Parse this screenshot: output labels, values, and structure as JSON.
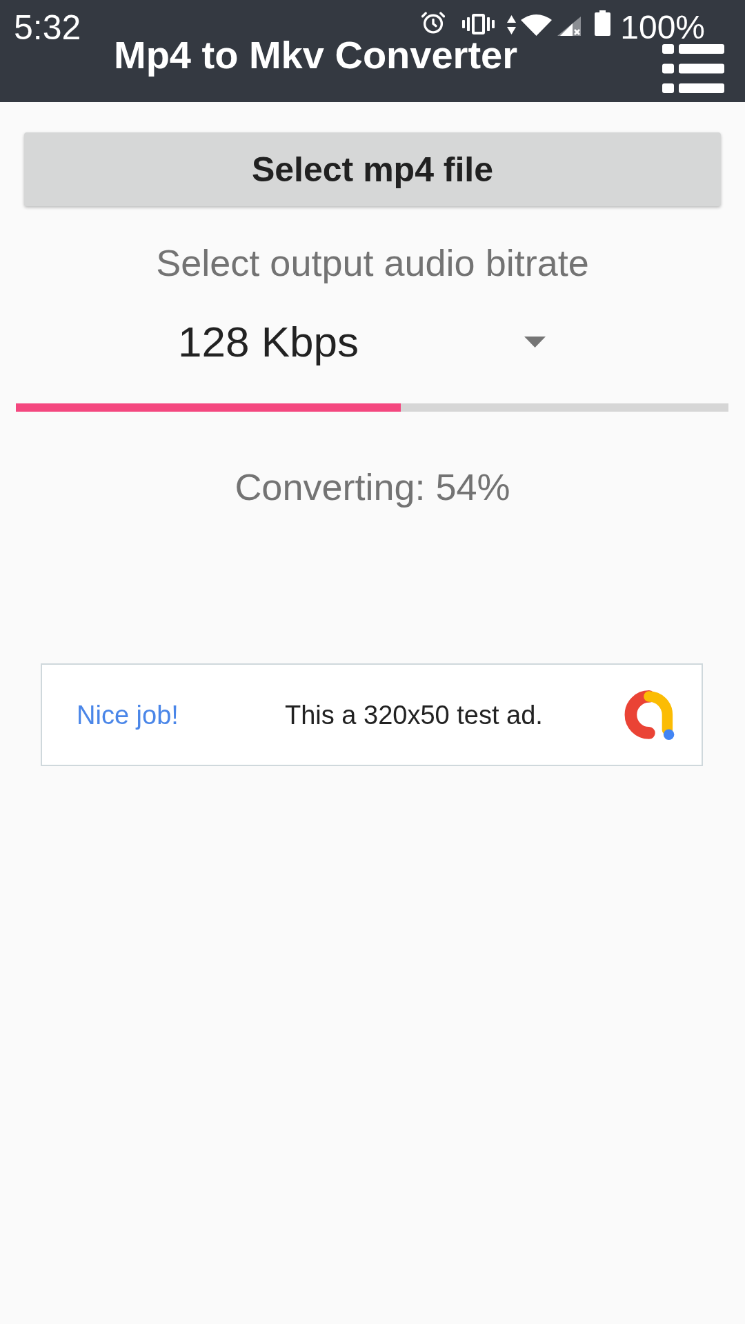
{
  "status_bar": {
    "time": "5:32",
    "battery": "100%"
  },
  "app_bar": {
    "title": "Mp4 to Mkv Converter"
  },
  "select_button": {
    "label": "Select mp4 file"
  },
  "bitrate": {
    "label": "Select output audio bitrate",
    "value": "128 Kbps"
  },
  "progress": {
    "level": 0.54,
    "text": "Converting: 54%"
  },
  "ad": {
    "headline": "Nice job!",
    "text": "This a 320x50 test ad."
  }
}
